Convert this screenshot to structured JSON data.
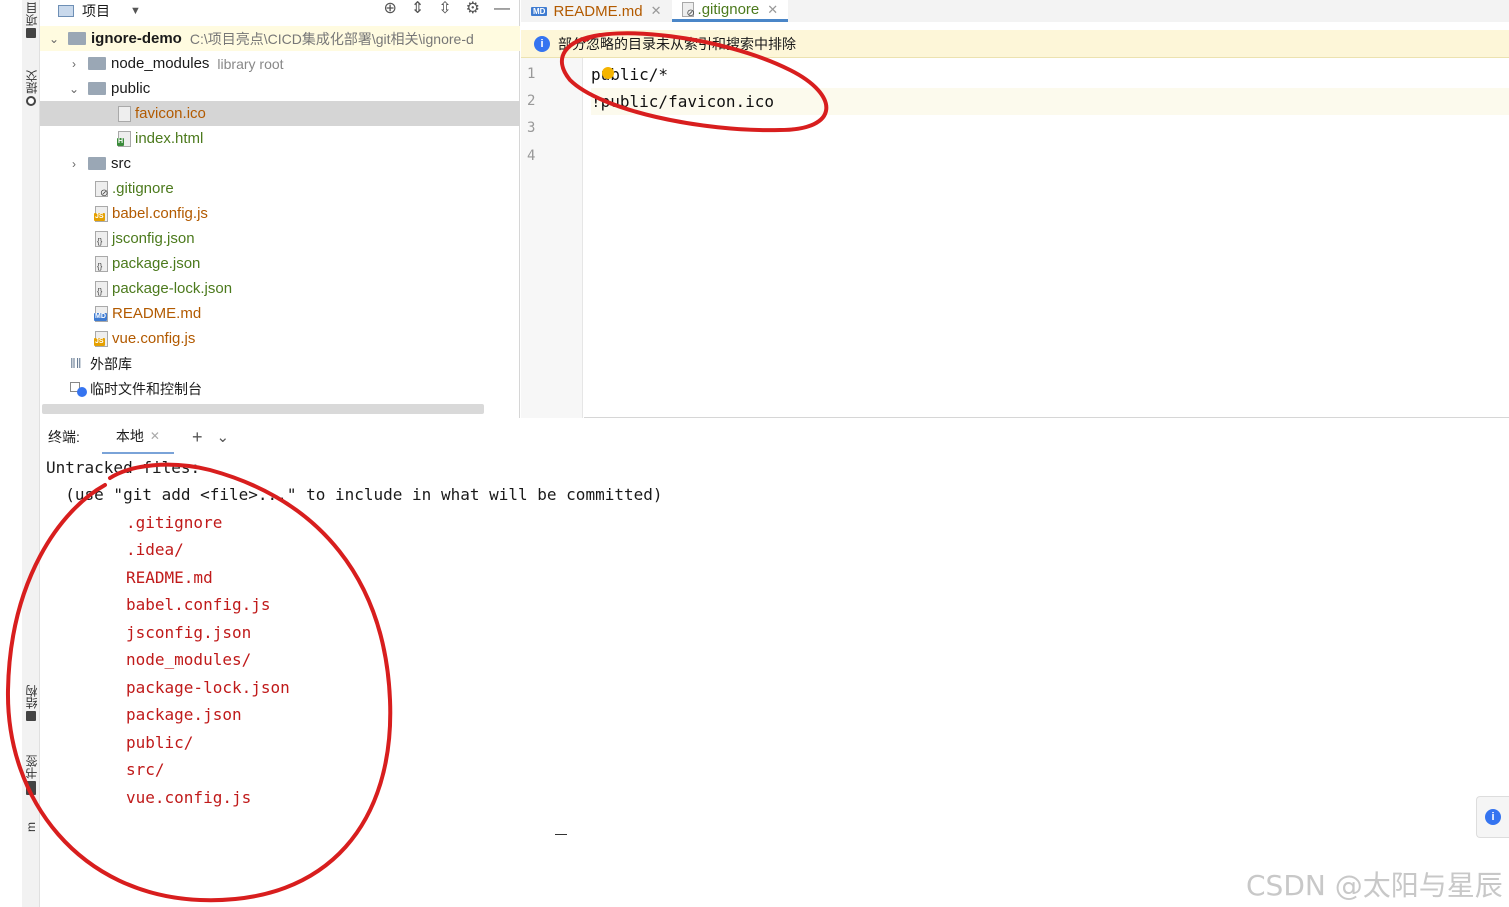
{
  "tool_strip": {
    "project_label": "项目",
    "commit_label": "提交",
    "structure_label": "结构",
    "bookmarks_label": "书签",
    "npm_label": "m"
  },
  "project_panel": {
    "title": "项目",
    "root": {
      "name": "ignore-demo",
      "path": "C:\\项目亮点\\CICD集成化部署\\git相关\\ignore-d"
    },
    "rows": [
      {
        "name": "node_modules",
        "note": "library root"
      },
      {
        "name": "public"
      },
      {
        "name": "favicon.ico"
      },
      {
        "name": "index.html"
      },
      {
        "name": "src"
      },
      {
        "name": ".gitignore"
      },
      {
        "name": "babel.config.js"
      },
      {
        "name": "jsconfig.json"
      },
      {
        "name": "package.json"
      },
      {
        "name": "package-lock.json"
      },
      {
        "name": "README.md"
      },
      {
        "name": "vue.config.js"
      },
      {
        "name": "外部库"
      },
      {
        "name": "临时文件和控制台"
      }
    ]
  },
  "editor_tabs": [
    {
      "label": "README.md",
      "badge": "MD"
    },
    {
      "label": ".gitignore"
    }
  ],
  "banner": {
    "text": "部分忽略的目录未从索引和搜索中排除"
  },
  "editor": {
    "line_numbers": [
      "1",
      "2",
      "3",
      "4"
    ],
    "lines": [
      "public/*",
      "!public/favicon.ico",
      "",
      ""
    ]
  },
  "terminal": {
    "label": "终端:",
    "tab_local": "本地",
    "lines": [
      "Untracked files:",
      "  (use \"git add <file>...\" to include in what will be committed)"
    ],
    "untracked": [
      ".gitignore",
      ".idea/",
      "README.md",
      "babel.config.js",
      "jsconfig.json",
      "node_modules/",
      "package-lock.json",
      "package.json",
      "public/",
      "src/",
      "vue.config.js"
    ]
  },
  "watermark": "CSDN @太阳与星辰",
  "colors": {
    "annotation": "#d81e1e",
    "accent": "#3574f0",
    "untracked": "#c01a1a"
  }
}
